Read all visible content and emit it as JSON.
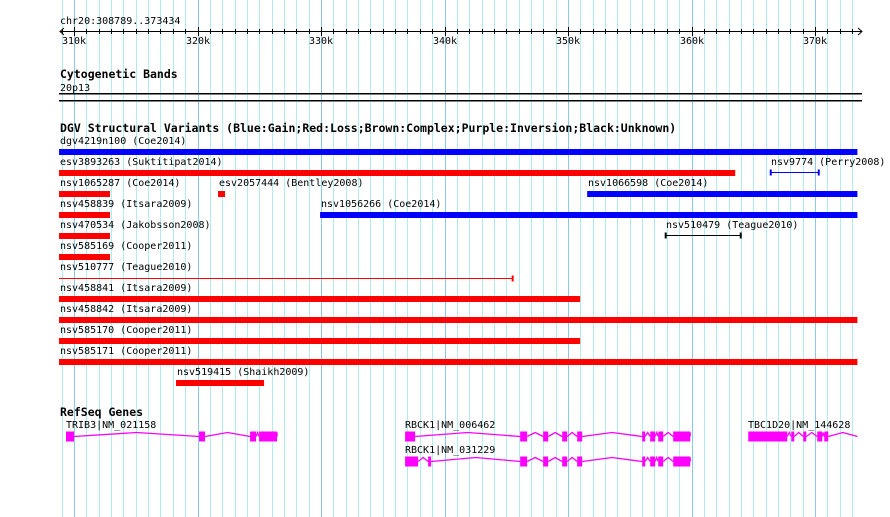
{
  "colors": {
    "gain": "#0000ff",
    "loss": "#ff0000",
    "unknown": "#000000",
    "gene": "#ff00ff",
    "grid_minor": "#b0ecf0",
    "grid_major": "#88c8e8"
  },
  "ruler": {
    "location": "chr20:308789..373434",
    "start": 308789,
    "end": 373434,
    "ticks": [
      {
        "pos": 310000,
        "label": "310k"
      },
      {
        "pos": 320000,
        "label": "320k"
      },
      {
        "pos": 330000,
        "label": "330k"
      },
      {
        "pos": 340000,
        "label": "340k"
      },
      {
        "pos": 350000,
        "label": "350k"
      },
      {
        "pos": 360000,
        "label": "360k"
      },
      {
        "pos": 370000,
        "label": "370k"
      }
    ]
  },
  "cytoband": {
    "title": "Cytogenetic Bands",
    "band": "20p13"
  },
  "dgv": {
    "title": "DGV Structural Variants (Blue:Gain;Red:Loss;Brown:Complex;Purple:Inversion;Black:Unknown)",
    "features": [
      {
        "label": "dgv4219n100 (Coe2014)",
        "start": 308789,
        "end": 373434,
        "type": "gain",
        "style": "bar",
        "row": 0
      },
      {
        "label": "esv3893263 (Suktitipat2014)",
        "start": 308789,
        "end": 363541,
        "type": "loss",
        "style": "bar",
        "row": 1
      },
      {
        "label": "nsv9774 (Perry2008)",
        "start": 366376,
        "end": 370345,
        "type": "gain",
        "style": "line",
        "row": 1
      },
      {
        "label": "nsv1065287 (Coe2014)",
        "start": 308789,
        "end": 312916,
        "type": "loss",
        "style": "bar",
        "row": 2
      },
      {
        "label": "esv2057444 (Bentley2008)",
        "start": 321664,
        "end": 322231,
        "type": "loss",
        "style": "bar",
        "row": 2
      },
      {
        "label": "nsv1066598 (Coe2014)",
        "start": 351553,
        "end": 373434,
        "type": "gain",
        "style": "bar",
        "row": 2
      },
      {
        "label": "nsv458839 (Itsara2009)",
        "start": 308789,
        "end": 312916,
        "type": "loss",
        "style": "bar",
        "row": 3
      },
      {
        "label": "nsv1056266 (Coe2014)",
        "start": 329926,
        "end": 373434,
        "type": "gain",
        "style": "bar",
        "row": 3
      },
      {
        "label": "nsv470534 (Jakobsson2008)",
        "start": 308789,
        "end": 312916,
        "type": "loss",
        "style": "bar",
        "row": 4
      },
      {
        "label": "nsv510479 (Teague2010)",
        "start": 357871,
        "end": 364027,
        "type": "unknown",
        "style": "line",
        "row": 4
      },
      {
        "label": "nsv585169 (Cooper2011)",
        "start": 308789,
        "end": 312916,
        "type": "loss",
        "style": "bar",
        "row": 5
      },
      {
        "label": "nsv510777 (Teague2010)",
        "start": 308789,
        "end": 345559,
        "type": "loss",
        "style": "line",
        "row": 6
      },
      {
        "label": "nsv458841 (Itsara2009)",
        "start": 308789,
        "end": 350986,
        "type": "loss",
        "style": "bar",
        "row": 7
      },
      {
        "label": "nsv458842 (Itsara2009)",
        "start": 308789,
        "end": 373434,
        "type": "loss",
        "style": "bar",
        "row": 8
      },
      {
        "label": "nsv585170 (Cooper2011)",
        "start": 308789,
        "end": 350986,
        "type": "loss",
        "style": "bar",
        "row": 9
      },
      {
        "label": "nsv585171 (Cooper2011)",
        "start": 308789,
        "end": 373434,
        "type": "loss",
        "style": "bar",
        "row": 10
      },
      {
        "label": "nsv519415 (Shaikh2009)",
        "start": 318262,
        "end": 325390,
        "type": "loss",
        "style": "bar",
        "row": 11
      }
    ]
  },
  "refseq": {
    "title": "RefSeq Genes",
    "genes": [
      {
        "label": "TRIB3|NM_021158",
        "row": 0,
        "start": 309352,
        "end": 326443,
        "exons": [
          [
            309352,
            310000
          ],
          [
            320125,
            320611
          ],
          [
            324256,
            324742
          ],
          [
            324985,
            326443
          ]
        ]
      },
      {
        "label": "RBCK1|NM_006462",
        "row": 0,
        "start": 336811,
        "end": 359896,
        "exons": [
          [
            336811,
            337621
          ],
          [
            346126,
            346693
          ],
          [
            347989,
            348394
          ],
          [
            349528,
            349933
          ],
          [
            350743,
            351148
          ],
          [
            356008,
            356251
          ],
          [
            356656,
            357061
          ],
          [
            357304,
            357709
          ],
          [
            358519,
            359896
          ]
        ]
      },
      {
        "label": "RBCK1|NM_031229",
        "row": 1,
        "start": 336811,
        "end": 359896,
        "exons": [
          [
            336811,
            337864
          ],
          [
            338674,
            338917
          ],
          [
            346126,
            346693
          ],
          [
            347989,
            348394
          ],
          [
            349528,
            349933
          ],
          [
            350743,
            351148
          ],
          [
            356008,
            356251
          ],
          [
            356656,
            357061
          ],
          [
            357304,
            357709
          ],
          [
            358519,
            359896
          ]
        ]
      },
      {
        "label": "TBC1D20|NM_144628",
        "row": 0,
        "start": 364594,
        "end": 373434,
        "exons": [
          [
            364594,
            367753
          ],
          [
            368077,
            368320
          ],
          [
            369049,
            369292
          ],
          [
            370183,
            370588
          ],
          [
            370750,
            371074
          ]
        ]
      }
    ]
  }
}
